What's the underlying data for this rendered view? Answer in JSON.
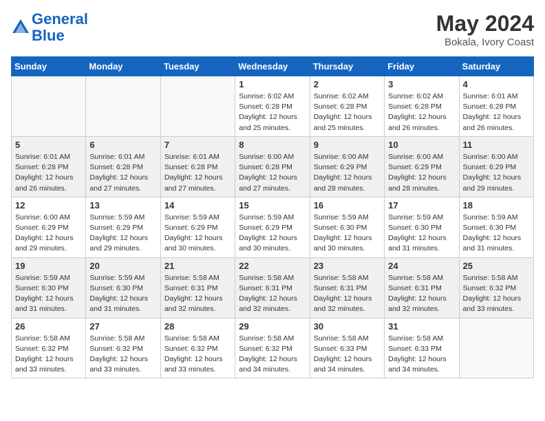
{
  "header": {
    "logo_line1": "General",
    "logo_line2": "Blue",
    "month_year": "May 2024",
    "location": "Bokala, Ivory Coast"
  },
  "weekdays": [
    "Sunday",
    "Monday",
    "Tuesday",
    "Wednesday",
    "Thursday",
    "Friday",
    "Saturday"
  ],
  "weeks": [
    [
      {
        "day": "",
        "info": ""
      },
      {
        "day": "",
        "info": ""
      },
      {
        "day": "",
        "info": ""
      },
      {
        "day": "1",
        "info": "Sunrise: 6:02 AM\nSunset: 6:28 PM\nDaylight: 12 hours\nand 25 minutes."
      },
      {
        "day": "2",
        "info": "Sunrise: 6:02 AM\nSunset: 6:28 PM\nDaylight: 12 hours\nand 25 minutes."
      },
      {
        "day": "3",
        "info": "Sunrise: 6:02 AM\nSunset: 6:28 PM\nDaylight: 12 hours\nand 26 minutes."
      },
      {
        "day": "4",
        "info": "Sunrise: 6:01 AM\nSunset: 6:28 PM\nDaylight: 12 hours\nand 26 minutes."
      }
    ],
    [
      {
        "day": "5",
        "info": "Sunrise: 6:01 AM\nSunset: 6:28 PM\nDaylight: 12 hours\nand 26 minutes."
      },
      {
        "day": "6",
        "info": "Sunrise: 6:01 AM\nSunset: 6:28 PM\nDaylight: 12 hours\nand 27 minutes."
      },
      {
        "day": "7",
        "info": "Sunrise: 6:01 AM\nSunset: 6:28 PM\nDaylight: 12 hours\nand 27 minutes."
      },
      {
        "day": "8",
        "info": "Sunrise: 6:00 AM\nSunset: 6:28 PM\nDaylight: 12 hours\nand 27 minutes."
      },
      {
        "day": "9",
        "info": "Sunrise: 6:00 AM\nSunset: 6:29 PM\nDaylight: 12 hours\nand 28 minutes."
      },
      {
        "day": "10",
        "info": "Sunrise: 6:00 AM\nSunset: 6:29 PM\nDaylight: 12 hours\nand 28 minutes."
      },
      {
        "day": "11",
        "info": "Sunrise: 6:00 AM\nSunset: 6:29 PM\nDaylight: 12 hours\nand 29 minutes."
      }
    ],
    [
      {
        "day": "12",
        "info": "Sunrise: 6:00 AM\nSunset: 6:29 PM\nDaylight: 12 hours\nand 29 minutes."
      },
      {
        "day": "13",
        "info": "Sunrise: 5:59 AM\nSunset: 6:29 PM\nDaylight: 12 hours\nand 29 minutes."
      },
      {
        "day": "14",
        "info": "Sunrise: 5:59 AM\nSunset: 6:29 PM\nDaylight: 12 hours\nand 30 minutes."
      },
      {
        "day": "15",
        "info": "Sunrise: 5:59 AM\nSunset: 6:29 PM\nDaylight: 12 hours\nand 30 minutes."
      },
      {
        "day": "16",
        "info": "Sunrise: 5:59 AM\nSunset: 6:30 PM\nDaylight: 12 hours\nand 30 minutes."
      },
      {
        "day": "17",
        "info": "Sunrise: 5:59 AM\nSunset: 6:30 PM\nDaylight: 12 hours\nand 31 minutes."
      },
      {
        "day": "18",
        "info": "Sunrise: 5:59 AM\nSunset: 6:30 PM\nDaylight: 12 hours\nand 31 minutes."
      }
    ],
    [
      {
        "day": "19",
        "info": "Sunrise: 5:59 AM\nSunset: 6:30 PM\nDaylight: 12 hours\nand 31 minutes."
      },
      {
        "day": "20",
        "info": "Sunrise: 5:59 AM\nSunset: 6:30 PM\nDaylight: 12 hours\nand 31 minutes."
      },
      {
        "day": "21",
        "info": "Sunrise: 5:58 AM\nSunset: 6:31 PM\nDaylight: 12 hours\nand 32 minutes."
      },
      {
        "day": "22",
        "info": "Sunrise: 5:58 AM\nSunset: 6:31 PM\nDaylight: 12 hours\nand 32 minutes."
      },
      {
        "day": "23",
        "info": "Sunrise: 5:58 AM\nSunset: 6:31 PM\nDaylight: 12 hours\nand 32 minutes."
      },
      {
        "day": "24",
        "info": "Sunrise: 5:58 AM\nSunset: 6:31 PM\nDaylight: 12 hours\nand 32 minutes."
      },
      {
        "day": "25",
        "info": "Sunrise: 5:58 AM\nSunset: 6:32 PM\nDaylight: 12 hours\nand 33 minutes."
      }
    ],
    [
      {
        "day": "26",
        "info": "Sunrise: 5:58 AM\nSunset: 6:32 PM\nDaylight: 12 hours\nand 33 minutes."
      },
      {
        "day": "27",
        "info": "Sunrise: 5:58 AM\nSunset: 6:32 PM\nDaylight: 12 hours\nand 33 minutes."
      },
      {
        "day": "28",
        "info": "Sunrise: 5:58 AM\nSunset: 6:32 PM\nDaylight: 12 hours\nand 33 minutes."
      },
      {
        "day": "29",
        "info": "Sunrise: 5:58 AM\nSunset: 6:32 PM\nDaylight: 12 hours\nand 34 minutes."
      },
      {
        "day": "30",
        "info": "Sunrise: 5:58 AM\nSunset: 6:33 PM\nDaylight: 12 hours\nand 34 minutes."
      },
      {
        "day": "31",
        "info": "Sunrise: 5:58 AM\nSunset: 6:33 PM\nDaylight: 12 hours\nand 34 minutes."
      },
      {
        "day": "",
        "info": ""
      }
    ]
  ]
}
